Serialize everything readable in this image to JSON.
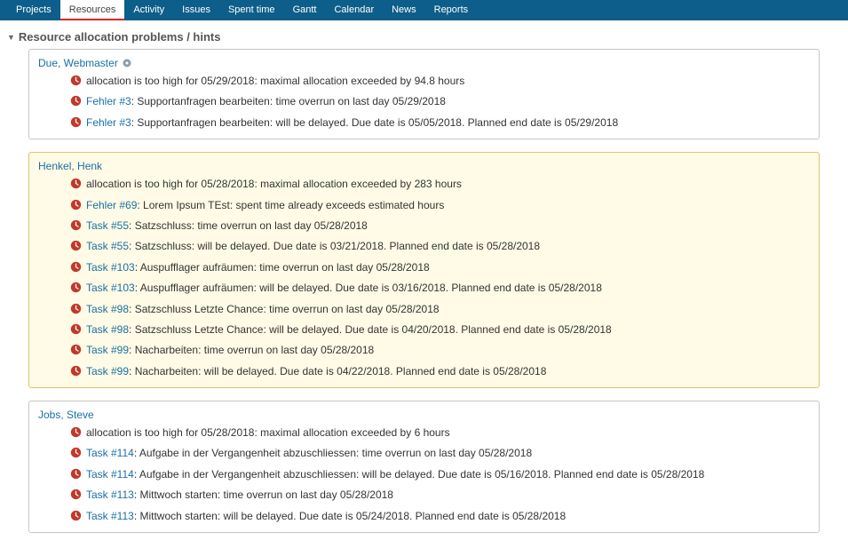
{
  "nav": {
    "items": [
      {
        "label": "Projects"
      },
      {
        "label": "Resources",
        "active": true
      },
      {
        "label": "Activity"
      },
      {
        "label": "Issues"
      },
      {
        "label": "Spent time"
      },
      {
        "label": "Gantt"
      },
      {
        "label": "Calendar"
      },
      {
        "label": "News"
      },
      {
        "label": "Reports"
      }
    ]
  },
  "section_title": "Resource allocation problems / hints",
  "cards": [
    {
      "title": "Due, Webmaster",
      "admin": true,
      "highlight": false,
      "lines": [
        {
          "link": null,
          "text": "allocation is too high for 05/29/2018: maximal allocation exceeded by 94.8 hours"
        },
        {
          "link": "Fehler #3",
          "text": "Supportanfragen bearbeiten: time overrun on last day 05/29/2018"
        },
        {
          "link": "Fehler #3",
          "text": "Supportanfragen bearbeiten: will be delayed. Due date is 05/05/2018. Planned end date is 05/29/2018"
        }
      ]
    },
    {
      "title": "Henkel, Henk",
      "admin": false,
      "highlight": true,
      "lines": [
        {
          "link": null,
          "text": "allocation is too high for 05/28/2018: maximal allocation exceeded by 283 hours"
        },
        {
          "link": "Fehler #69",
          "text": "Lorem Ipsum TEst: spent time already exceeds estimated hours"
        },
        {
          "link": "Task #55",
          "text": "Satzschluss: time overrun on last day 05/28/2018"
        },
        {
          "link": "Task #55",
          "text": "Satzschluss: will be delayed. Due date is 03/21/2018. Planned end date is 05/28/2018"
        },
        {
          "link": "Task #103",
          "text": "Auspufflager aufräumen: time overrun on last day 05/28/2018"
        },
        {
          "link": "Task #103",
          "text": "Auspufflager aufräumen: will be delayed. Due date is 03/16/2018. Planned end date is 05/28/2018"
        },
        {
          "link": "Task #98",
          "text": "Satzschluss Letzte Chance: time overrun on last day 05/28/2018"
        },
        {
          "link": "Task #98",
          "text": "Satzschluss Letzte Chance: will be delayed. Due date is 04/20/2018. Planned end date is 05/28/2018"
        },
        {
          "link": "Task #99",
          "text": "Nacharbeiten: time overrun on last day 05/28/2018"
        },
        {
          "link": "Task #99",
          "text": "Nacharbeiten: will be delayed. Due date is 04/22/2018. Planned end date is 05/28/2018"
        }
      ]
    },
    {
      "title": "Jobs, Steve",
      "admin": false,
      "highlight": false,
      "lines": [
        {
          "link": null,
          "text": "allocation is too high for 05/28/2018: maximal allocation exceeded by 6 hours"
        },
        {
          "link": "Task #114",
          "text": "Aufgabe in der Vergangenheit abzuschliessen: time overrun on last day 05/28/2018"
        },
        {
          "link": "Task #114",
          "text": "Aufgabe in der Vergangenheit abzuschliessen: will be delayed. Due date is 05/16/2018. Planned end date is 05/28/2018"
        },
        {
          "link": "Task #113",
          "text": "Mittwoch starten: time overrun on last day 05/28/2018"
        },
        {
          "link": "Task #113",
          "text": "Mittwoch starten: will be delayed. Due date is 05/24/2018. Planned end date is 05/28/2018"
        }
      ]
    }
  ]
}
